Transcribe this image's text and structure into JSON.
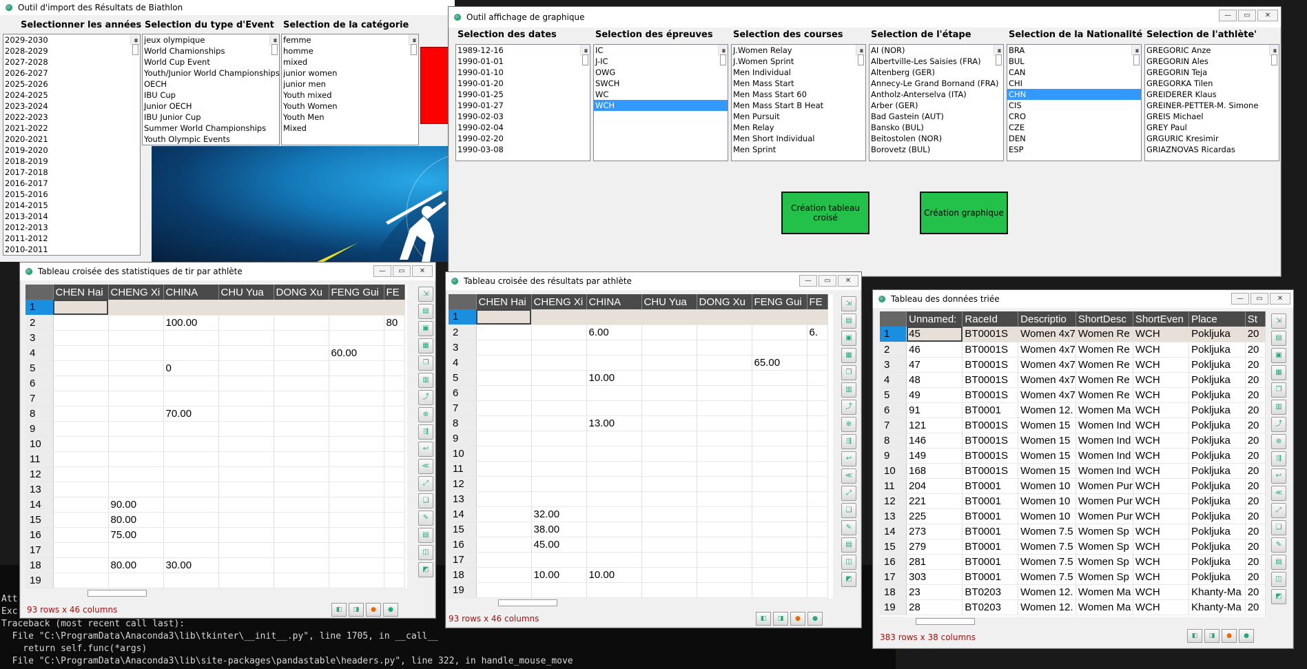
{
  "console": {
    "lines": [
      "Att",
      "Exc",
      "Traceback (most recent call last):",
      "  File \"C:\\ProgramData\\Anaconda3\\lib\\tkinter\\__init__.py\", line 1705, in __call__",
      "    return self.func(*args)",
      "  File \"C:\\ProgramData\\Anaconda3\\lib\\site-packages\\pandastable\\headers.py\", line 322, in handle_mouse_move"
    ]
  },
  "import_win": {
    "title": "Outil d'import des Résultats de Biathlon",
    "col1_label": "Selectionner les années",
    "col2_label": "Selection du type d'Event",
    "col3_label": "Selection de la catégorie",
    "years": [
      "2029-2030",
      "2028-2029",
      "2027-2028",
      "2026-2027",
      "2025-2026",
      "2024-2025",
      "2023-2024",
      "2022-2023",
      "2021-2022",
      "2020-2021",
      "2019-2020",
      "2018-2019",
      "2017-2018",
      "2016-2017",
      "2015-2016",
      "2014-2015",
      "2013-2014",
      "2012-2013",
      "2011-2012",
      "2010-2011"
    ],
    "events": [
      "jeux olympique",
      "World Chamionships",
      "World Cup Event",
      "Youth/Junior World Championships",
      "OECH",
      "IBU Cup",
      "Junior OECH",
      "IBU Junior Cup",
      "Summer World Championships",
      "Youth Olympic Events"
    ],
    "categories": [
      "femme",
      "homme",
      "mixed",
      "junior women",
      "junior men",
      "Youth mixed",
      "Youth Women",
      "Youth Men",
      "Mixed"
    ]
  },
  "graph_win": {
    "title": "Outil affichage de graphique",
    "labels": [
      "Selection des dates",
      "Selection des épreuves",
      "Selection des courses",
      "Selection de l'étape",
      "Selection de la Nationalité",
      "Selection de l'athlète'"
    ],
    "dates": [
      "1989-12-16",
      "1990-01-01",
      "1990-01-10",
      "1990-01-20",
      "1990-01-25",
      "1990-01-27",
      "1990-02-03",
      "1990-02-04",
      "1990-02-20",
      "1990-03-08"
    ],
    "epreuves": [
      "IC",
      "J-IC",
      "OWG",
      "SWCH",
      "WC",
      "WCH"
    ],
    "courses": [
      "J.Women Relay",
      "J.Women Sprint",
      "Men Individual",
      "Men Mass Start",
      "Men Mass Start 60",
      "Men Mass Start B Heat",
      "Men Pursuit",
      "Men Relay",
      "Men Short Individual",
      "Men Sprint"
    ],
    "etapes": [
      "AI (NOR)",
      "Albertville-Les Saisies (FRA)",
      "Altenberg (GER)",
      "Annecy-Le Grand Bornand (FRA)",
      "Antholz-Anterselva (ITA)",
      "Arber (GER)",
      "Bad Gastein (AUT)",
      "Bansko (BUL)",
      "Beitostolen (NOR)",
      "Borovetz (BUL)"
    ],
    "nations": [
      "BRA",
      "BUL",
      "CAN",
      "CHI",
      "CHN",
      "CIS",
      "CRO",
      "CZE",
      "DEN",
      "ESP"
    ],
    "athletes": [
      "GREGORIC Anze",
      "GREGORIN Ales",
      "GREGORIN Teja",
      "GREGORKA Tilen",
      "GREIDERER Klaus",
      "GREINER-PETTER-M. Simone",
      "GREIS Michael",
      "GREY Paul",
      "GRGURIC Kresimir",
      "GRIAZNOVAS Ricardas"
    ],
    "btn_cross": "Création tableau croisé",
    "btn_graph": "Création graphique"
  },
  "tir_win": {
    "title": "Tableau croisée des statistiques de tir par athlète",
    "headers": [
      "CHEN Hai",
      "CHENG Xi",
      "CHINA",
      "CHU Yua",
      "DONG Xu",
      "FENG Gui",
      "FE"
    ],
    "rows": [
      [
        "1",
        "",
        "",
        "",
        "",
        "",
        "",
        ""
      ],
      [
        "2",
        "",
        "",
        "100.00",
        "",
        "",
        "",
        "80"
      ],
      [
        "3",
        "",
        "",
        "",
        "",
        "",
        "",
        ""
      ],
      [
        "4",
        "",
        "",
        "",
        "",
        "",
        "60.00",
        ""
      ],
      [
        "5",
        "",
        "",
        "0",
        "",
        "",
        "",
        ""
      ],
      [
        "6",
        "",
        "",
        "",
        "",
        "",
        "",
        ""
      ],
      [
        "7",
        "",
        "",
        "",
        "",
        "",
        "",
        ""
      ],
      [
        "8",
        "",
        "",
        "70.00",
        "",
        "",
        "",
        ""
      ],
      [
        "9",
        "",
        "",
        "",
        "",
        "",
        "",
        ""
      ],
      [
        "10",
        "",
        "",
        "",
        "",
        "",
        "",
        ""
      ],
      [
        "11",
        "",
        "",
        "",
        "",
        "",
        "",
        ""
      ],
      [
        "12",
        "",
        "",
        "",
        "",
        "",
        "",
        ""
      ],
      [
        "13",
        "",
        "",
        "",
        "",
        "",
        "",
        ""
      ],
      [
        "14",
        "",
        "90.00",
        "",
        "",
        "",
        "",
        ""
      ],
      [
        "15",
        "",
        "80.00",
        "",
        "",
        "",
        "",
        ""
      ],
      [
        "16",
        "",
        "75.00",
        "",
        "",
        "",
        "",
        ""
      ],
      [
        "17",
        "",
        "",
        "",
        "",
        "",
        "",
        ""
      ],
      [
        "18",
        "",
        "80.00",
        "30.00",
        "",
        "",
        "",
        ""
      ],
      [
        "19",
        "",
        "",
        "",
        "",
        "",
        "",
        ""
      ]
    ],
    "status": "93 rows x 46 columns"
  },
  "res_win": {
    "title": "Tableau croisée des résultats par athlète",
    "headers": [
      "CHEN Hai",
      "CHENG Xi",
      "CHINA",
      "CHU Yua",
      "DONG Xu",
      "FENG Gui",
      "FE"
    ],
    "rows": [
      [
        "1",
        "",
        "",
        "",
        "",
        "",
        "",
        ""
      ],
      [
        "2",
        "",
        "",
        "6.00",
        "",
        "",
        "",
        "6."
      ],
      [
        "3",
        "",
        "",
        "",
        "",
        "",
        "",
        ""
      ],
      [
        "4",
        "",
        "",
        "",
        "",
        "",
        "65.00",
        ""
      ],
      [
        "5",
        "",
        "",
        "10.00",
        "",
        "",
        "",
        ""
      ],
      [
        "6",
        "",
        "",
        "",
        "",
        "",
        "",
        ""
      ],
      [
        "7",
        "",
        "",
        "",
        "",
        "",
        "",
        ""
      ],
      [
        "8",
        "",
        "",
        "13.00",
        "",
        "",
        "",
        ""
      ],
      [
        "9",
        "",
        "",
        "",
        "",
        "",
        "",
        ""
      ],
      [
        "10",
        "",
        "",
        "",
        "",
        "",
        "",
        ""
      ],
      [
        "11",
        "",
        "",
        "",
        "",
        "",
        "",
        ""
      ],
      [
        "12",
        "",
        "",
        "",
        "",
        "",
        "",
        ""
      ],
      [
        "13",
        "",
        "",
        "",
        "",
        "",
        "",
        ""
      ],
      [
        "14",
        "",
        "32.00",
        "",
        "",
        "",
        "",
        ""
      ],
      [
        "15",
        "",
        "38.00",
        "",
        "",
        "",
        "",
        ""
      ],
      [
        "16",
        "",
        "45.00",
        "",
        "",
        "",
        "",
        ""
      ],
      [
        "17",
        "",
        "",
        "",
        "",
        "",
        "",
        ""
      ],
      [
        "18",
        "",
        "10.00",
        "10.00",
        "",
        "",
        "",
        ""
      ],
      [
        "19",
        "",
        "",
        "",
        "",
        "",
        "",
        ""
      ]
    ],
    "status": "93 rows x 46 columns"
  },
  "data_win": {
    "title": "Tableau des données triée",
    "headers": [
      "Unnamed:",
      "RaceId",
      "Descriptio",
      "ShortDesc",
      "ShortEven",
      "Place",
      "St"
    ],
    "rows": [
      [
        "1",
        "45",
        "BT0001S",
        "Women 4x7",
        "Women Re",
        "WCH",
        "Pokljuka",
        "20"
      ],
      [
        "2",
        "46",
        "BT0001S",
        "Women 4x7",
        "Women Re",
        "WCH",
        "Pokljuka",
        "20"
      ],
      [
        "3",
        "47",
        "BT0001S",
        "Women 4x7",
        "Women Re",
        "WCH",
        "Pokljuka",
        "20"
      ],
      [
        "4",
        "48",
        "BT0001S",
        "Women 4x7",
        "Women Re",
        "WCH",
        "Pokljuka",
        "20"
      ],
      [
        "5",
        "49",
        "BT0001S",
        "Women 4x7",
        "Women Re",
        "WCH",
        "Pokljuka",
        "20"
      ],
      [
        "6",
        "91",
        "BT0001",
        "Women 12.",
        "Women Ma",
        "WCH",
        "Pokljuka",
        "20"
      ],
      [
        "7",
        "121",
        "BT0001S",
        "Women 15",
        "Women Ind",
        "WCH",
        "Pokljuka",
        "20"
      ],
      [
        "8",
        "146",
        "BT0001S",
        "Women 15",
        "Women Ind",
        "WCH",
        "Pokljuka",
        "20"
      ],
      [
        "9",
        "149",
        "BT0001S",
        "Women 15",
        "Women Ind",
        "WCH",
        "Pokljuka",
        "20"
      ],
      [
        "10",
        "168",
        "BT0001S",
        "Women 15",
        "Women Ind",
        "WCH",
        "Pokljuka",
        "20"
      ],
      [
        "11",
        "204",
        "BT0001",
        "Women 10",
        "Women Pur",
        "WCH",
        "Pokljuka",
        "20"
      ],
      [
        "12",
        "221",
        "BT0001",
        "Women 10",
        "Women Pur",
        "WCH",
        "Pokljuka",
        "20"
      ],
      [
        "13",
        "225",
        "BT0001",
        "Women 10",
        "Women Pur",
        "WCH",
        "Pokljuka",
        "20"
      ],
      [
        "14",
        "273",
        "BT0001",
        "Women 7.5",
        "Women Sp",
        "WCH",
        "Pokljuka",
        "20"
      ],
      [
        "15",
        "279",
        "BT0001",
        "Women 7.5",
        "Women Sp",
        "WCH",
        "Pokljuka",
        "20"
      ],
      [
        "16",
        "281",
        "BT0001",
        "Women 7.5",
        "Women Sp",
        "WCH",
        "Pokljuka",
        "20"
      ],
      [
        "17",
        "303",
        "BT0001",
        "Women 7.5",
        "Women Sp",
        "WCH",
        "Pokljuka",
        "20"
      ],
      [
        "18",
        "23",
        "BT0203",
        "Women 12.",
        "Women Ma",
        "WCH",
        "Khanty-Ma",
        "20"
      ],
      [
        "19",
        "28",
        "BT0203",
        "Women 12.",
        "Women Ma",
        "WCH",
        "Khanty-Ma",
        "20"
      ]
    ],
    "status": "383 rows x 38 columns"
  }
}
